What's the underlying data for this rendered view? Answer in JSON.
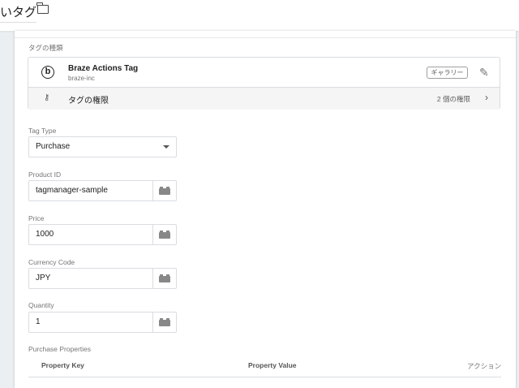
{
  "header": {
    "title": "いタグ",
    "folder_icon": "folder-icon"
  },
  "tag_type_section": {
    "label": "タグの種類",
    "tag_name": "Braze Actions Tag",
    "tag_vendor": "braze-inc",
    "gallery_badge": "ギャラリー",
    "permissions_label": "タグの権限",
    "permissions_count": "2 個の権限"
  },
  "fields": [
    {
      "label": "Tag Type",
      "value": "Purchase"
    },
    {
      "label": "Product ID",
      "value": "tagmanager-sample"
    },
    {
      "label": "Price",
      "value": "1000"
    },
    {
      "label": "Currency Code",
      "value": "JPY"
    },
    {
      "label": "Quantity",
      "value": "1"
    }
  ],
  "purchase_properties": {
    "label": "Purchase Properties",
    "columns": [
      "Property Key",
      "Property Value",
      "アクション"
    ]
  }
}
